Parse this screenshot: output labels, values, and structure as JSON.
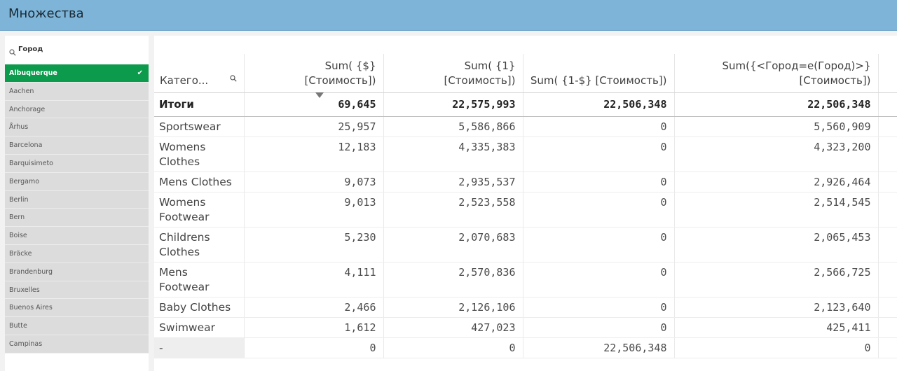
{
  "app": {
    "title": "Множества"
  },
  "filter": {
    "search_label": "Город",
    "selected": "Albuquerque",
    "items": [
      "Aachen",
      "Anchorage",
      "Århus",
      "Barcelona",
      "Barquisimeto",
      "Bergamo",
      "Berlin",
      "Bern",
      "Boise",
      "Bräcke",
      "Brandenburg",
      "Bruxelles",
      "Buenos Aires",
      "Butte",
      "Campinas"
    ]
  },
  "table": {
    "headers": [
      "Катего...",
      "Sum( {$} [Стоимость])",
      "Sum( {1} [Стоимость])",
      "Sum( {1-$} [Стоимость])",
      "Sum({<Город=e(Город)>} [Стоимость])"
    ],
    "totals": {
      "label": "Итоги",
      "values": [
        "69,645",
        "22,575,993",
        "22,506,348",
        "22,506,348"
      ]
    },
    "rows": [
      {
        "label": "Sportswear",
        "values": [
          "25,957",
          "5,586,866",
          "0",
          "5,560,909"
        ]
      },
      {
        "label": "Womens Clothes",
        "values": [
          "12,183",
          "4,335,383",
          "0",
          "4,323,200"
        ]
      },
      {
        "label": "Mens Clothes",
        "values": [
          "9,073",
          "2,935,537",
          "0",
          "2,926,464"
        ]
      },
      {
        "label": "Womens Footwear",
        "values": [
          "9,013",
          "2,523,558",
          "0",
          "2,514,545"
        ]
      },
      {
        "label": "Childrens Clothes",
        "values": [
          "5,230",
          "2,070,683",
          "0",
          "2,065,453"
        ]
      },
      {
        "label": "Mens Footwear",
        "values": [
          "4,111",
          "2,570,836",
          "0",
          "2,566,725"
        ]
      },
      {
        "label": "Baby Clothes",
        "values": [
          "2,466",
          "2,126,106",
          "0",
          "2,123,640"
        ]
      },
      {
        "label": "Swimwear",
        "values": [
          "1,612",
          "427,023",
          "0",
          "425,411"
        ]
      },
      {
        "label": "-",
        "values": [
          "0",
          "0",
          "22,506,348",
          "0"
        ]
      }
    ]
  }
}
